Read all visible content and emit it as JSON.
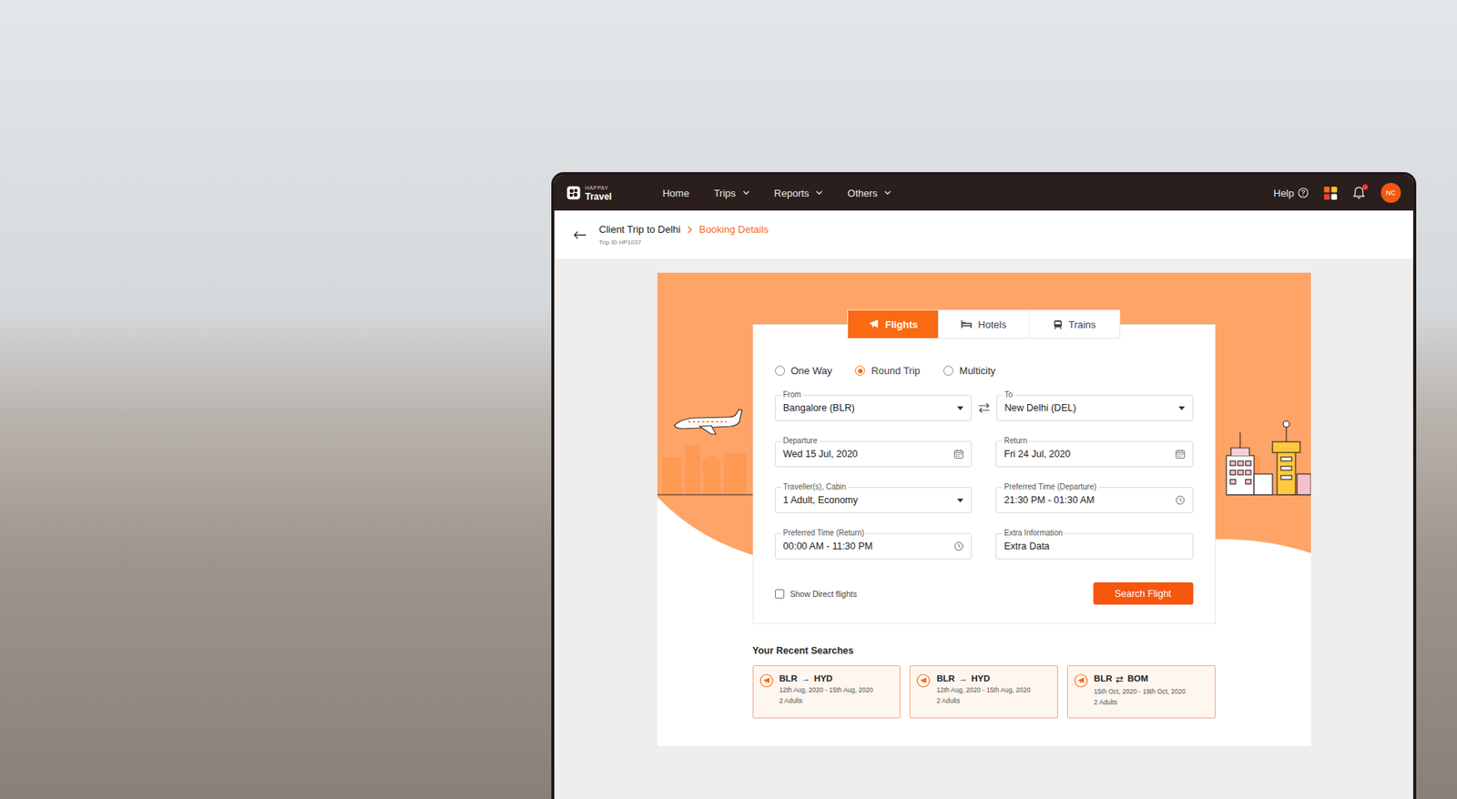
{
  "app": {
    "brand_small": "HAPPAY",
    "brand": "Travel"
  },
  "nav": [
    {
      "label": "Home",
      "dropdown": false
    },
    {
      "label": "Trips",
      "dropdown": true
    },
    {
      "label": "Reports",
      "dropdown": true
    },
    {
      "label": "Others",
      "dropdown": true
    }
  ],
  "header_actions": {
    "help": "Help",
    "has_notifications": true,
    "avatar": "NC"
  },
  "breadcrumb": {
    "parent": "Client Trip to Delhi",
    "current": "Booking Details",
    "trip_id": "Trip ID HP1037"
  },
  "tabs": [
    {
      "label": "Flights",
      "selected": true,
      "kind": "flight"
    },
    {
      "label": "Hotels",
      "selected": false,
      "kind": "hotel"
    },
    {
      "label": "Trains",
      "selected": false,
      "kind": "train"
    }
  ],
  "trip_types": [
    {
      "label": "One Way",
      "selected": false
    },
    {
      "label": "Round Trip",
      "selected": true
    },
    {
      "label": "Multicity",
      "selected": false
    }
  ],
  "route": {
    "from": {
      "label": "From",
      "value": "Bangalore (BLR)"
    },
    "to": {
      "label": "To",
      "value": "New Delhi (DEL)"
    }
  },
  "fields": [
    {
      "label": "Departure",
      "value": "Wed 15 Jul, 2020",
      "kind": "date"
    },
    {
      "label": "Return",
      "value": "Fri 24 Jul, 2020",
      "kind": "date"
    },
    {
      "label": "Traveller(s), Cabin",
      "value": "1 Adult, Economy",
      "kind": "select"
    },
    {
      "label": "Preferred Time (Departure)",
      "value": "21:30 PM - 01:30 AM",
      "kind": "time"
    },
    {
      "label": "Preferred Time (Return)",
      "value": "00:00 AM - 11:30 PM",
      "kind": "time"
    },
    {
      "label": "Extra Information",
      "value": "Extra Data",
      "kind": "text"
    }
  ],
  "direct_flights": {
    "label": "Show Direct flights",
    "checked": false
  },
  "search_button": "Search Flight",
  "recent": {
    "title": "Your Recent Searches",
    "items": [
      {
        "from": "BLR",
        "arrow": "→",
        "to": "HYD",
        "dates": "12th Aug, 2020 - 15th Aug, 2020",
        "travellers": "2 Adults"
      },
      {
        "from": "BLR",
        "arrow": "→",
        "to": "HYD",
        "dates": "12th Aug, 2020 - 15th Aug, 2020",
        "travellers": "2 Adults"
      },
      {
        "from": "BLR",
        "arrow": "⇄",
        "to": "BOM",
        "dates": "15th Oct, 2020 - 19th Oct, 2020",
        "travellers": "2 Adults"
      }
    ]
  }
}
